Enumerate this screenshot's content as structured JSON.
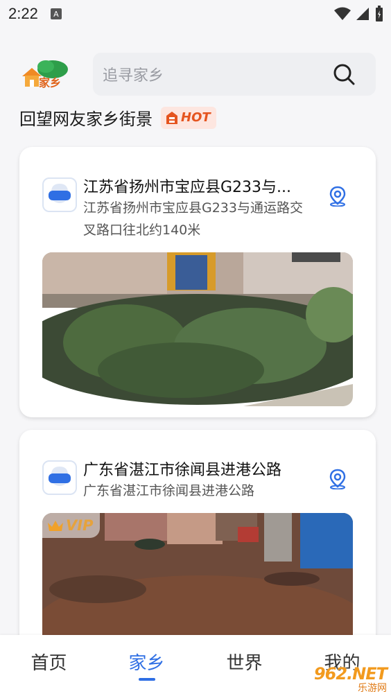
{
  "status_bar": {
    "time": "2:22",
    "app_icon_letter": "A"
  },
  "header": {
    "logo_text": "家乡",
    "search_placeholder": "追寻家乡",
    "search_icon": "search-icon"
  },
  "section": {
    "title": "回望网友家乡街景",
    "hot_badge": "HOT"
  },
  "cards": [
    {
      "title": "江苏省扬州市宝应县G233与...",
      "address": "江苏省扬州市宝应县G233与通运路交叉路口往北约140米",
      "vip": false,
      "icon": "location-pin-icon"
    },
    {
      "title": "广东省湛江市徐闻县进港公路",
      "address": "广东省湛江市徐闻县进港公路",
      "vip": true,
      "vip_label": "VIP",
      "icon": "location-pin-icon"
    }
  ],
  "tabs": [
    {
      "label": "首页",
      "active": false
    },
    {
      "label": "家乡",
      "active": true
    },
    {
      "label": "世界",
      "active": false
    },
    {
      "label": "我的",
      "active": false
    }
  ],
  "watermark": {
    "top": "962.NET",
    "bottom": "乐游网"
  },
  "colors": {
    "accent": "#2f6fe4",
    "hot": "#e5541f",
    "vip": "#e6a23c"
  }
}
